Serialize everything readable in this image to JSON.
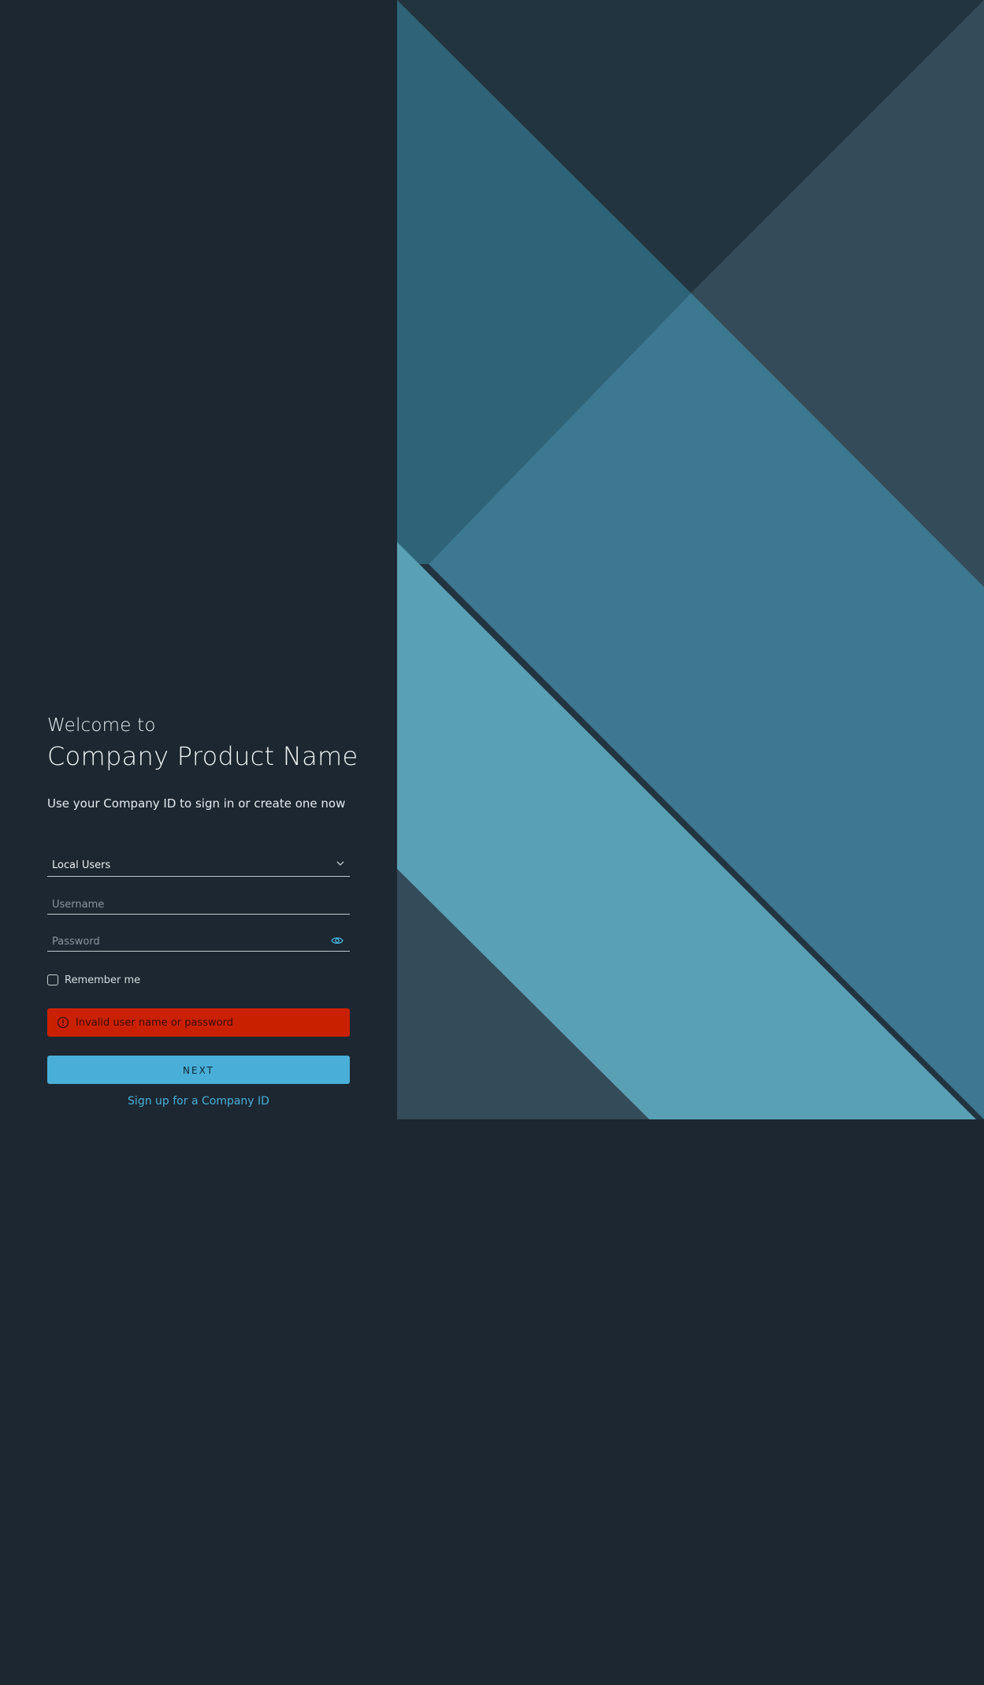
{
  "welcome": {
    "greeting": "Welcome to",
    "product_name": "Company Product Name",
    "tagline": "Use your Company ID to sign in or create one now"
  },
  "form": {
    "auth_source": {
      "selected": "Local Users",
      "icon": "chevron-down-icon"
    },
    "username": {
      "value": "",
      "placeholder": "Username"
    },
    "password": {
      "value": "",
      "placeholder": "Password",
      "icon": "eye-icon"
    },
    "remember_me": {
      "label": "Remember me",
      "checked": false
    },
    "error": {
      "message": "Invalid user name or password",
      "icon": "exclamation-circle-icon"
    },
    "next_label": "NEXT",
    "signup_label": "Sign up for a Company ID"
  },
  "colors": {
    "background": "#1c2731",
    "accent": "#49afd9",
    "error": "#c92100",
    "hero_dark": "#22343f",
    "hero_teal": "#2f6478",
    "hero_mid": "#3d7891",
    "hero_light": "#5aa0b5",
    "hero_slate": "#344b59"
  }
}
